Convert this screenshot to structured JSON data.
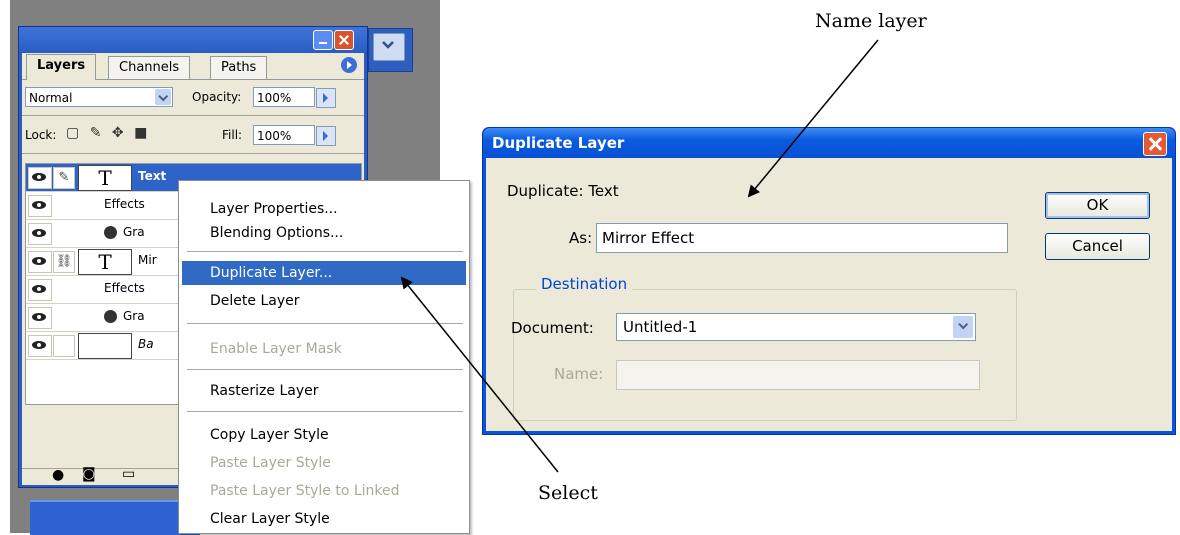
{
  "layers_palette": {
    "tabs": [
      "Layers",
      "Channels",
      "Paths"
    ],
    "blend_mode": "Normal",
    "opacity_label": "Opacity:",
    "opacity_value": "100%",
    "lock_label": "Lock:",
    "fill_label": "Fill:",
    "fill_value": "100%",
    "layers": [
      {
        "name": "Text",
        "thumb": "T",
        "selected": true
      },
      {
        "name": "Effects",
        "thumb": ""
      },
      {
        "name": "Gra",
        "thumb": ""
      },
      {
        "name": "Mir",
        "thumb": "T"
      },
      {
        "name": "Effects",
        "thumb": ""
      },
      {
        "name": "Gra",
        "thumb": ""
      },
      {
        "name": "Ba",
        "thumb": ""
      }
    ]
  },
  "context_menu": {
    "items": [
      {
        "label": "Layer Properties...",
        "state": "normal"
      },
      {
        "label": "Blending Options...",
        "state": "normal"
      },
      {
        "label": "Duplicate Layer...",
        "state": "highlighted"
      },
      {
        "label": "Delete Layer",
        "state": "normal"
      },
      {
        "label": "Enable Layer Mask",
        "state": "disabled"
      },
      {
        "label": "Rasterize Layer",
        "state": "normal"
      },
      {
        "label": "Copy Layer Style",
        "state": "normal"
      },
      {
        "label": "Paste Layer Style",
        "state": "disabled"
      },
      {
        "label": "Paste Layer Style to Linked",
        "state": "disabled"
      },
      {
        "label": "Clear Layer Style",
        "state": "normal"
      }
    ]
  },
  "dialog": {
    "title": "Duplicate Layer",
    "duplicate_label": "Duplicate:",
    "duplicate_value": "Text",
    "as_label": "As:",
    "as_value": "Mirror Effect",
    "destination_label": "Destination",
    "document_label": "Document:",
    "document_value": "Untitled-1",
    "name_label": "Name:",
    "name_value": "",
    "ok_label": "OK",
    "cancel_label": "Cancel"
  },
  "annotations": {
    "name_layer": "Name layer",
    "select": "Select"
  },
  "colors": {
    "xp_blue": "#0855dd",
    "menu_highlight": "#316ac5",
    "dialog_face": "#ece9d8"
  }
}
